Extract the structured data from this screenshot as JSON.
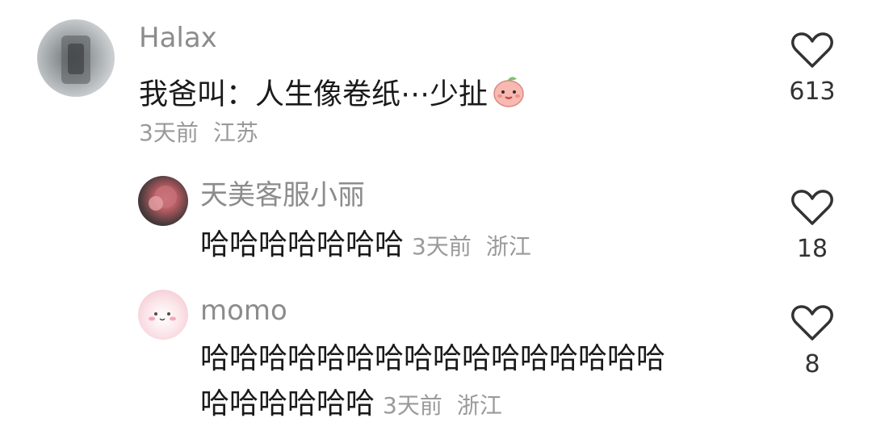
{
  "comments": [
    {
      "username": "Halax",
      "text": "我爸叫：人生像卷纸⋯少扯",
      "time": "3天前",
      "location": "江苏",
      "likes": "613",
      "emoji": "peach-face-emoji"
    },
    {
      "username": "天美客服小丽",
      "text": "哈哈哈哈哈哈哈",
      "time": "3天前",
      "location": "浙江",
      "likes": "18"
    },
    {
      "username": "momo",
      "text_line1": "哈哈哈哈哈哈哈哈哈哈哈哈哈哈哈哈",
      "text_line2": "哈哈哈哈哈哈",
      "time": "3天前",
      "location": "浙江",
      "likes": "8"
    }
  ],
  "colors": {
    "username": "#8c8c8c",
    "text": "#1a1a1a",
    "meta": "#9a9a9a",
    "heart_outline": "#333333"
  }
}
